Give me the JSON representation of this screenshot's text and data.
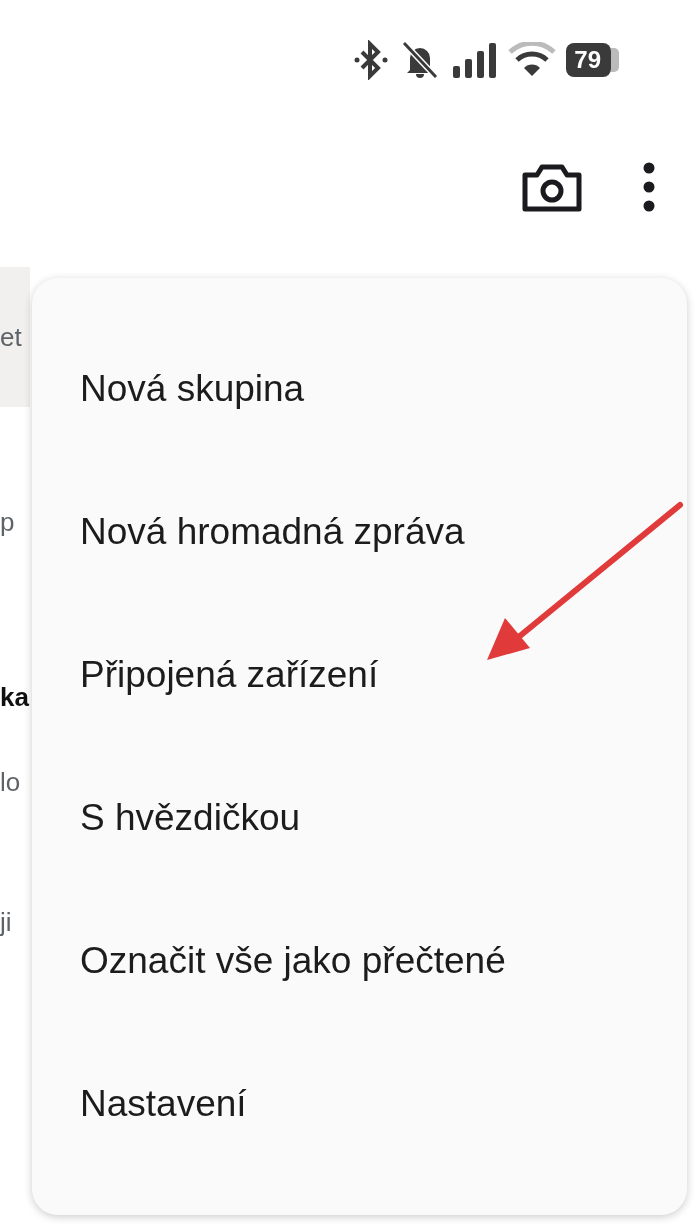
{
  "status_bar": {
    "battery": "79"
  },
  "background_fragments": [
    {
      "text": "et",
      "kind": "band"
    },
    {
      "text": "p",
      "kind": "muted"
    },
    {
      "text": "ka",
      "kind": "bold"
    },
    {
      "text": "lo",
      "kind": "muted"
    },
    {
      "text": "ji",
      "kind": "muted"
    }
  ],
  "menu": {
    "items": [
      {
        "label": "Nová skupina"
      },
      {
        "label": "Nová hromadná zpráva"
      },
      {
        "label": "Připojená zařízení"
      },
      {
        "label": "S hvězdičkou"
      },
      {
        "label": "Označit vše jako přečtené"
      },
      {
        "label": "Nastavení"
      }
    ]
  }
}
